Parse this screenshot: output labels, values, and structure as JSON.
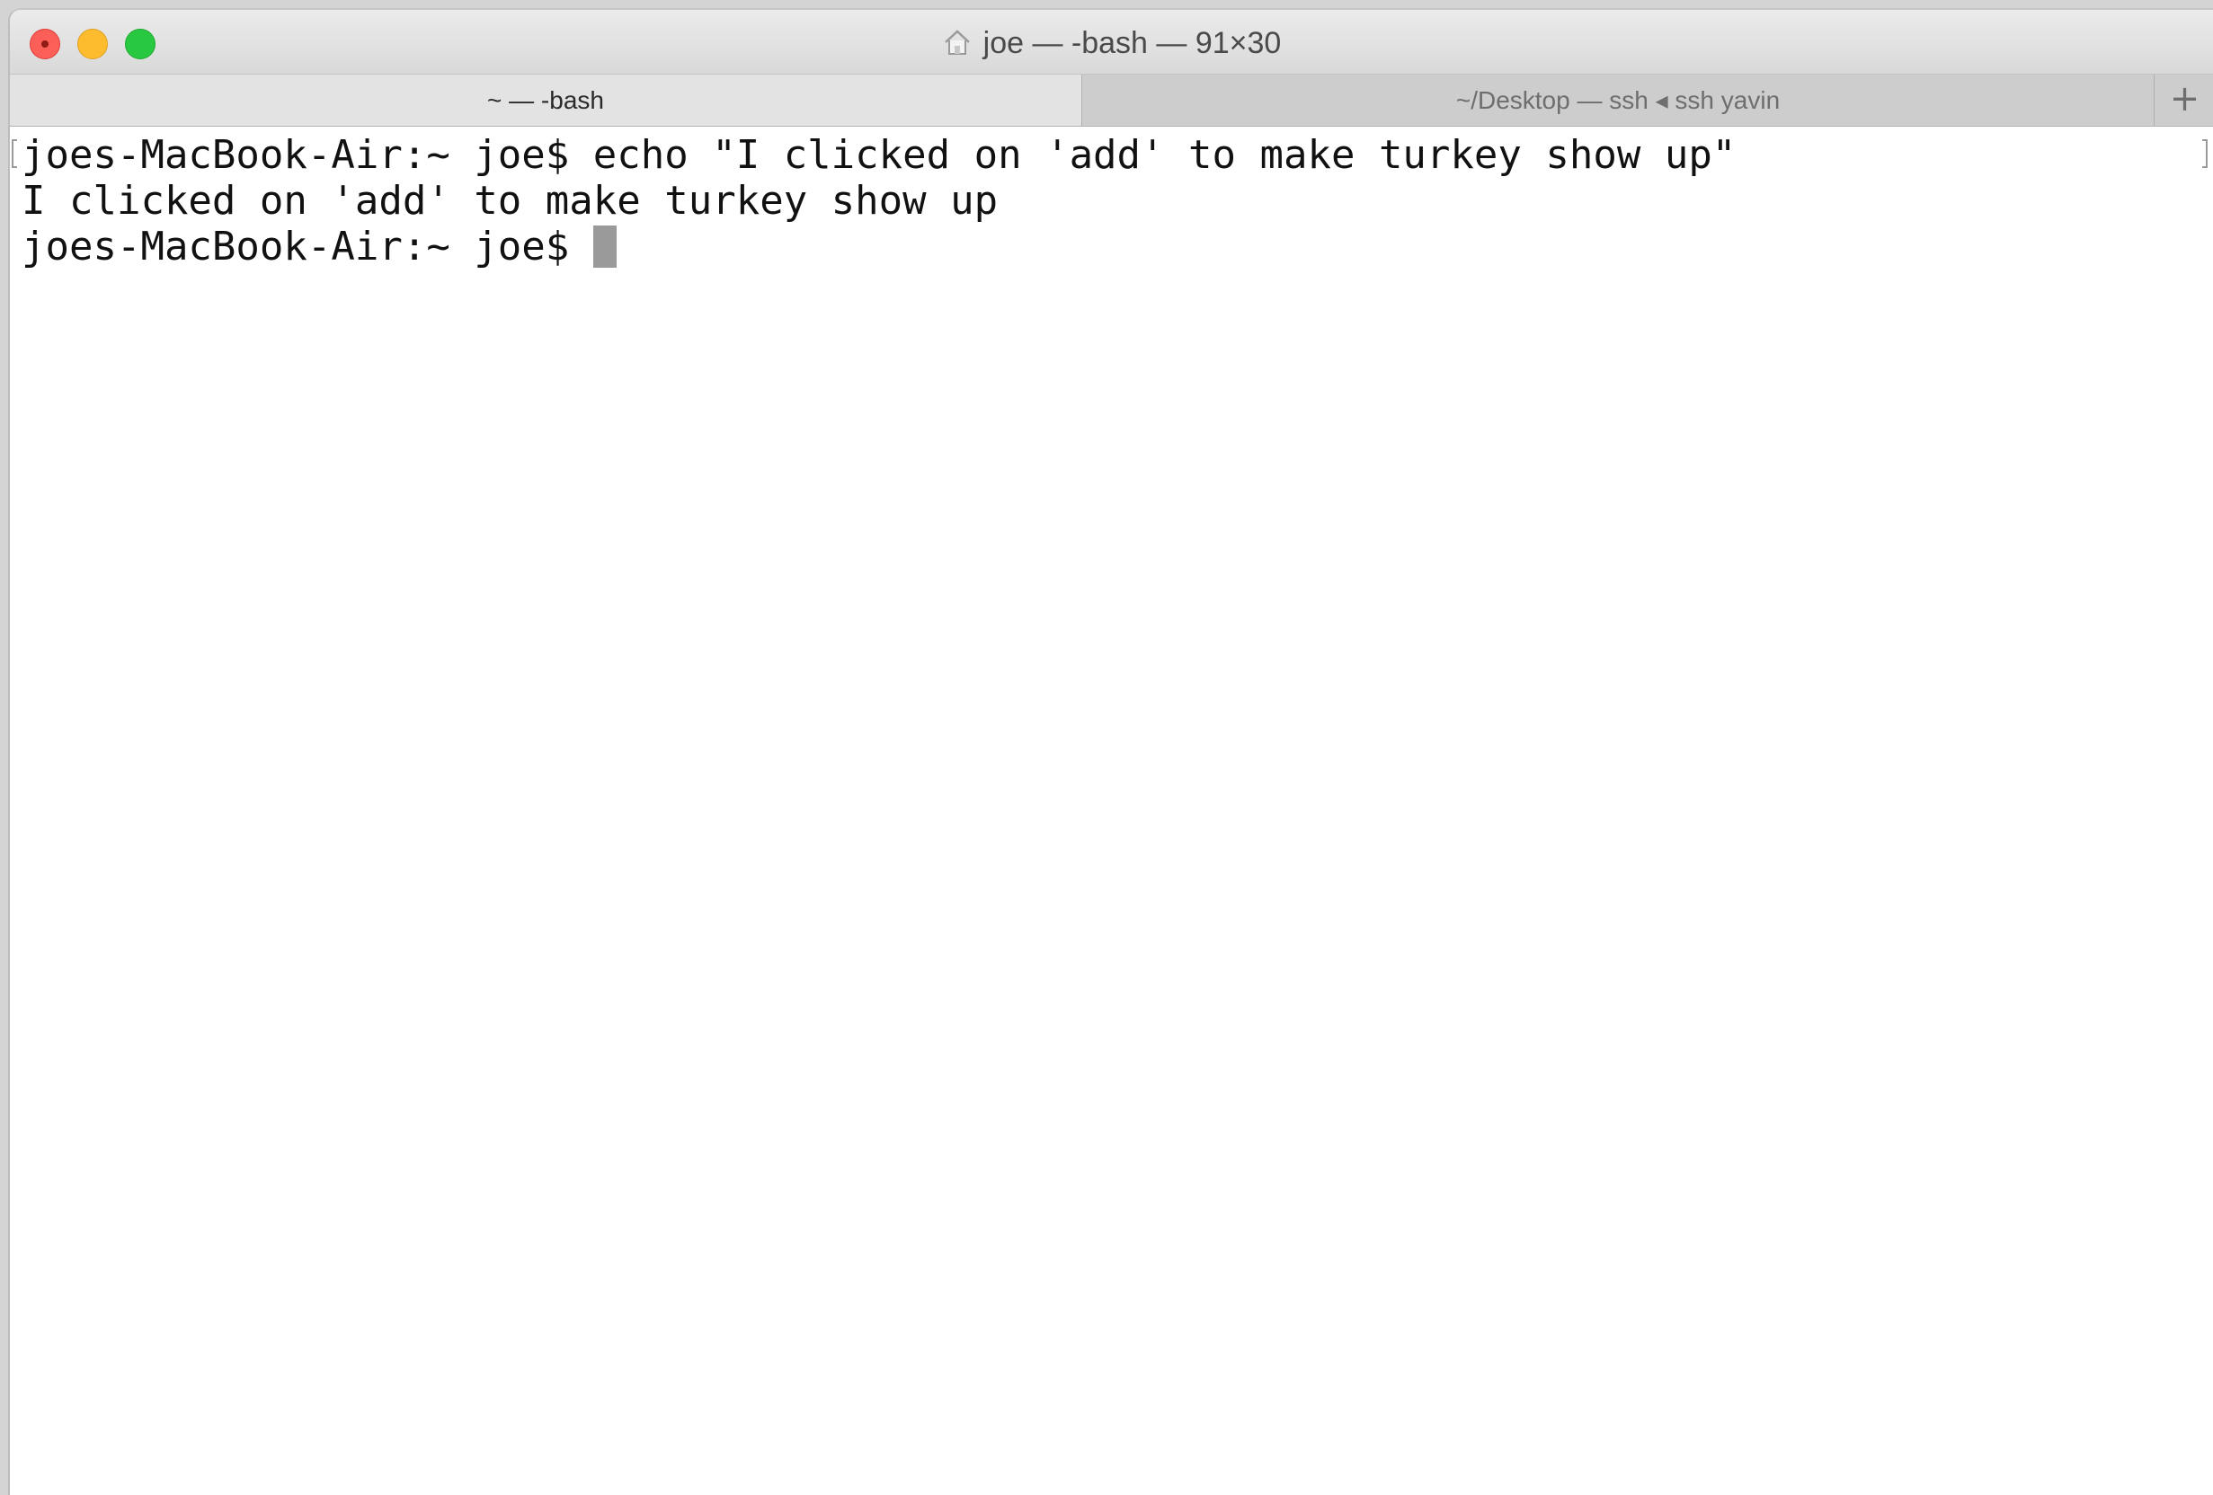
{
  "window": {
    "title": "joe — -bash — 91×30",
    "title_icon": "home-icon"
  },
  "tabs": [
    {
      "label": "~ — -bash",
      "active": true
    },
    {
      "label": "~/Desktop — ssh ◂ ssh yavin",
      "active": false
    }
  ],
  "new_tab_label": "+",
  "terminal": {
    "lines": [
      "joes-MacBook-Air:~ joe$ echo \"I clicked on 'add' to make turkey show up\"",
      "I clicked on 'add' to make turkey show up",
      "joes-MacBook-Air:~ joe$ "
    ]
  },
  "colors": {
    "close": "#fc5f57",
    "minimize": "#fdbc2e",
    "maximize": "#28c840",
    "cursor": "#9a9a9a"
  }
}
